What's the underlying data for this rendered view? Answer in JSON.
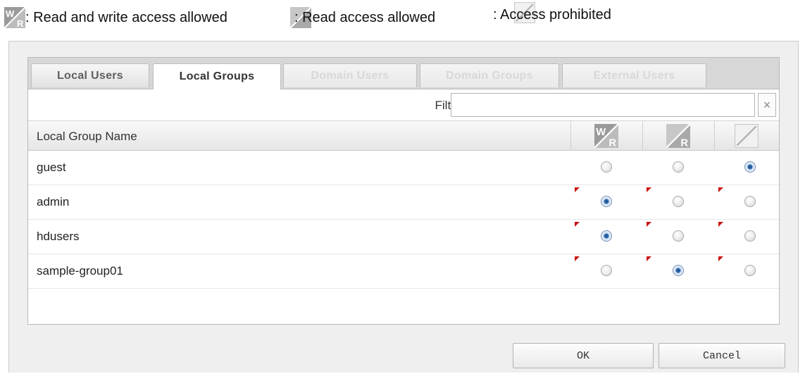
{
  "legend": {
    "read_write": "Read and write access allowed",
    "read_write_prefix": ": ",
    "read_only": ": Read access allowed",
    "prohibited": ": Access prohibited"
  },
  "tabs": [
    {
      "label": "Local Users",
      "state": "normal"
    },
    {
      "label": "Local Groups",
      "state": "active"
    },
    {
      "label": "Domain Users",
      "state": "disabled"
    },
    {
      "label": "Domain Groups",
      "state": "disabled"
    },
    {
      "label": "External Users",
      "state": "disabled"
    }
  ],
  "filter": {
    "label": "Filter:",
    "value": "",
    "clear_symbol": "×"
  },
  "table": {
    "column_name": "Local Group Name",
    "columns": [
      "read-write-icon",
      "read-only-icon",
      "access-prohibited-icon"
    ],
    "rows": [
      {
        "name": "guest",
        "selected": 2,
        "flagged": false
      },
      {
        "name": "admin",
        "selected": 0,
        "flagged": true
      },
      {
        "name": "hdusers",
        "selected": 0,
        "flagged": true
      },
      {
        "name": "sample-group01",
        "selected": 1,
        "flagged": true
      }
    ]
  },
  "buttons": {
    "ok": "OK",
    "cancel": "Cancel"
  },
  "colors": {
    "selected_radio": "#2f6db0",
    "flag": "#cc1111",
    "icon_wr": "#8c8c8c"
  }
}
